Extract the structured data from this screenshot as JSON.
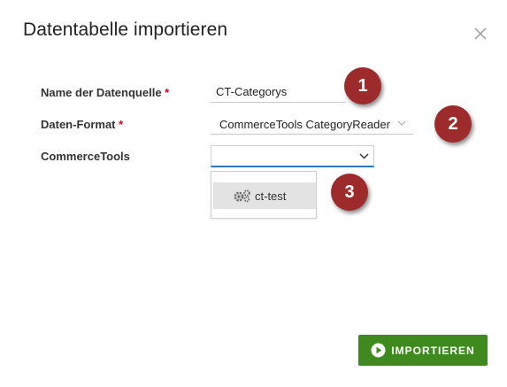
{
  "dialog": {
    "title": "Datentabelle importieren",
    "close_icon": "close-icon"
  },
  "form": {
    "name_label": "Name der Datenquelle",
    "name_required": "*",
    "name_value": "CT-Categorys",
    "format_label": "Daten-Format",
    "format_required": "*",
    "format_value": "CommerceTools CategoryReader",
    "commercetools_label": "CommerceTools",
    "commercetools_value": "",
    "commercetools_options": [
      "ct-test"
    ],
    "option_icon": "gears-icon"
  },
  "annotations": [
    "1",
    "2",
    "3"
  ],
  "footer": {
    "import_label": "IMPORTIEREN",
    "import_icon": "play-circle-icon"
  },
  "colors": {
    "required": "#d0021b",
    "badge": "#9e2b2b",
    "import_button": "#3e8a1e",
    "focus_border": "#2d77c7"
  }
}
